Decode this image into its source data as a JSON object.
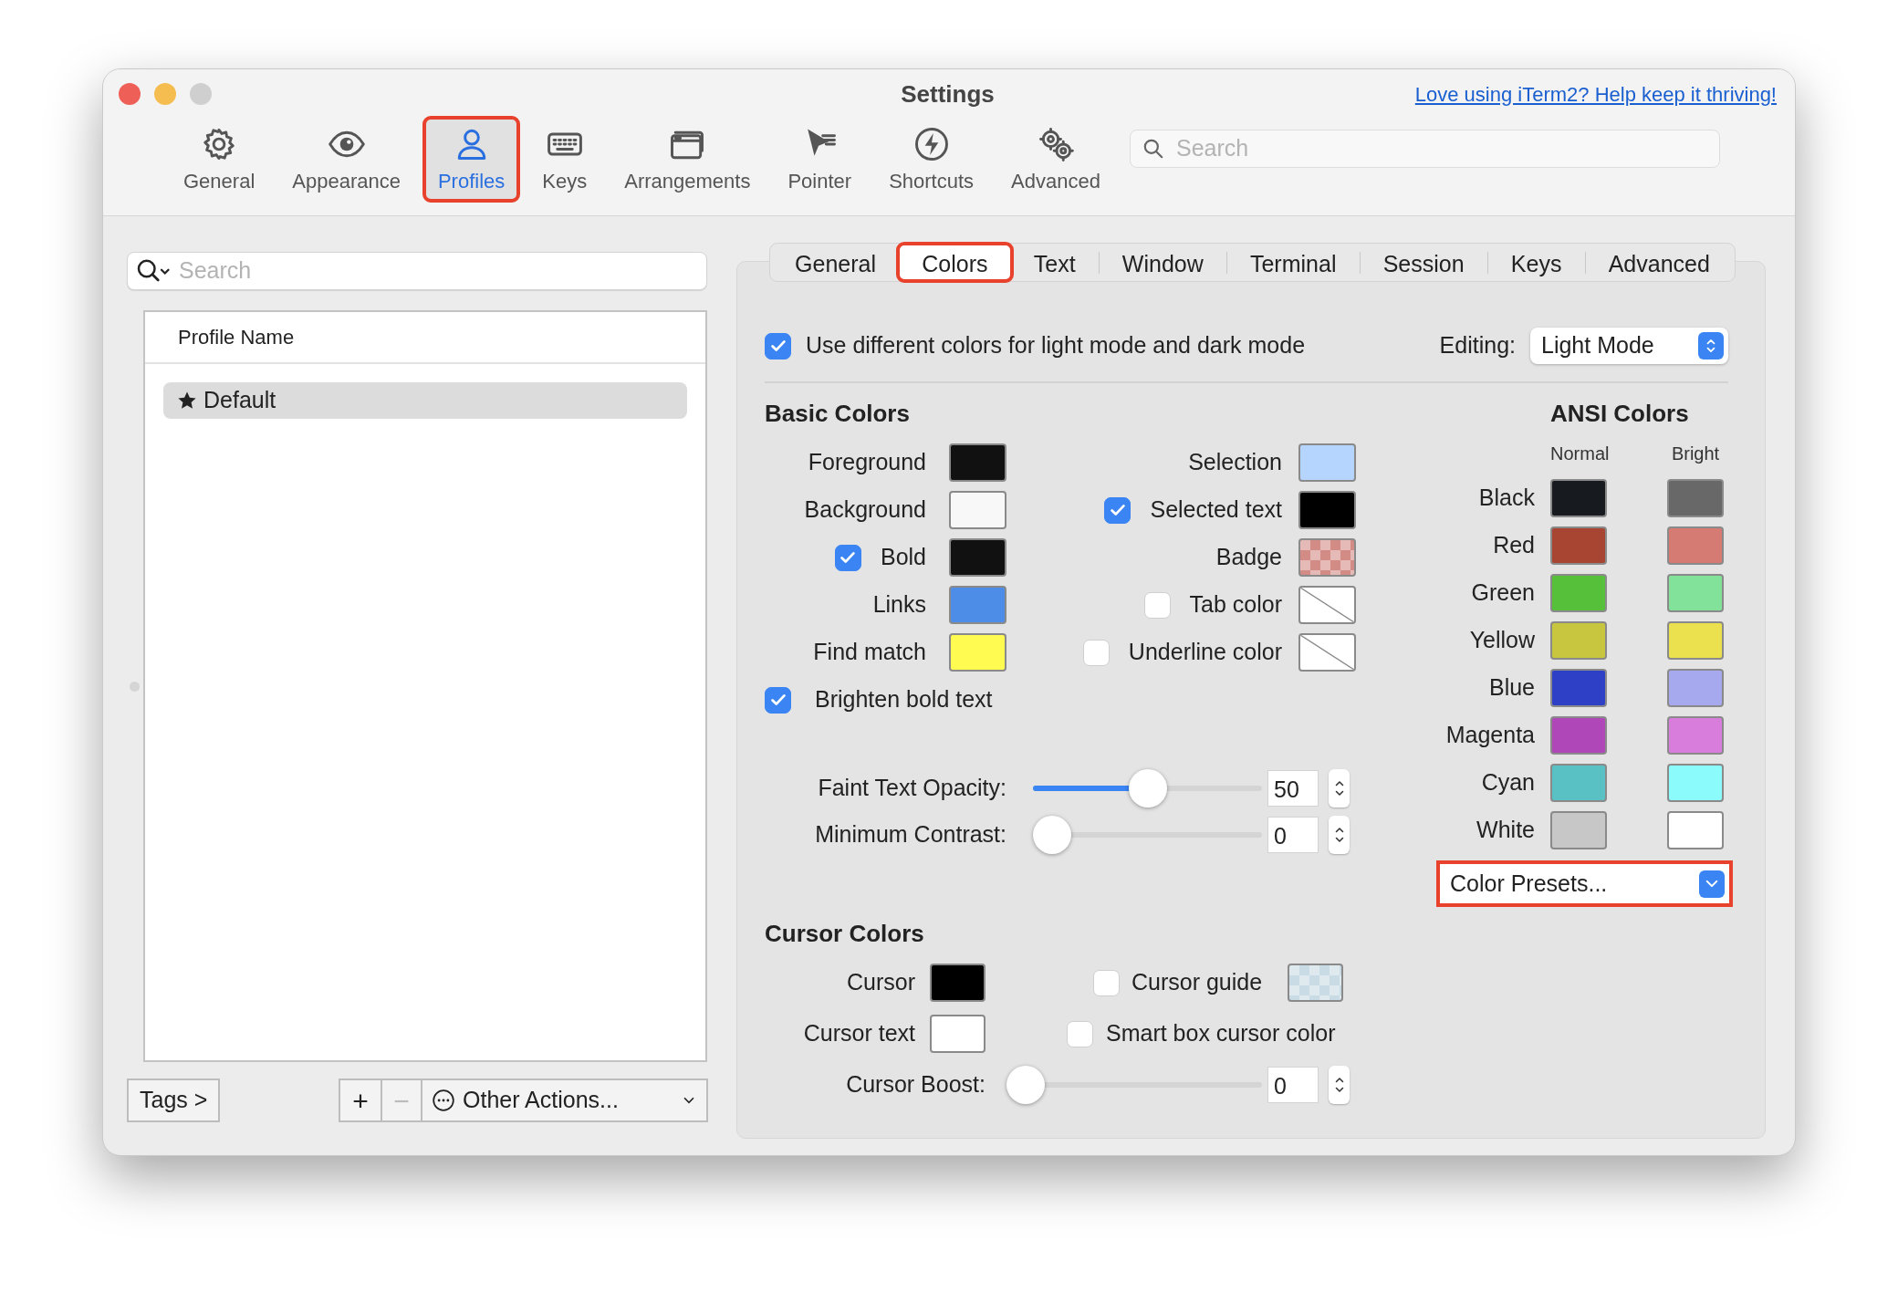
{
  "window": {
    "title": "Settings"
  },
  "promo_link": "Love using iTerm2? Help keep it thriving!",
  "toolbar": {
    "items": [
      {
        "label": "General",
        "selected": false,
        "highlighted": false
      },
      {
        "label": "Appearance",
        "selected": false,
        "highlighted": false
      },
      {
        "label": "Profiles",
        "selected": true,
        "highlighted": true
      },
      {
        "label": "Keys",
        "selected": false,
        "highlighted": false
      },
      {
        "label": "Arrangements",
        "selected": false,
        "highlighted": false
      },
      {
        "label": "Pointer",
        "selected": false,
        "highlighted": false
      },
      {
        "label": "Shortcuts",
        "selected": false,
        "highlighted": false
      },
      {
        "label": "Advanced",
        "selected": false,
        "highlighted": false
      }
    ],
    "search": {
      "placeholder": "Search"
    }
  },
  "profiles": {
    "search": {
      "placeholder": "Search"
    },
    "column": "Profile Name",
    "rows": [
      {
        "name": "Default",
        "selected": true
      }
    ],
    "tags_button": "Tags >",
    "add_button": "+",
    "remove_button": "−",
    "other_actions": "Other Actions..."
  },
  "tabs": [
    {
      "label": "General",
      "selected": false,
      "highlighted": false
    },
    {
      "label": "Colors",
      "selected": true,
      "highlighted": true
    },
    {
      "label": "Text",
      "selected": false,
      "highlighted": false
    },
    {
      "label": "Window",
      "selected": false,
      "highlighted": false
    },
    {
      "label": "Terminal",
      "selected": false,
      "highlighted": false
    },
    {
      "label": "Session",
      "selected": false,
      "highlighted": false
    },
    {
      "label": "Keys",
      "selected": false,
      "highlighted": false
    },
    {
      "label": "Advanced",
      "selected": false,
      "highlighted": false
    }
  ],
  "mode_checkbox": {
    "label": "Use different colors for light mode and dark mode",
    "checked": true
  },
  "editing": {
    "label": "Editing:",
    "value": "Light Mode"
  },
  "basic_colors": {
    "title": "Basic Colors",
    "left": [
      {
        "label": "Foreground",
        "kind": "solid",
        "color": "#111111"
      },
      {
        "label": "Background",
        "kind": "solid",
        "color": "#f8f8f8"
      },
      {
        "label": "Bold",
        "checked": true,
        "kind": "solid",
        "color": "#111111"
      },
      {
        "label": "Links",
        "kind": "solid",
        "color": "#4d8de8"
      },
      {
        "label": "Find match",
        "kind": "solid",
        "color": "#fffb50"
      }
    ],
    "right": [
      {
        "label": "Selection",
        "kind": "solid",
        "color": "#b5d5ff"
      },
      {
        "label": "Selected text",
        "checked": true,
        "kind": "solid",
        "color": "#000000"
      },
      {
        "label": "Badge",
        "kind": "checker",
        "color": "#d38b86"
      },
      {
        "label": "Tab color",
        "checked": false,
        "kind": "empty"
      },
      {
        "label": "Underline color",
        "checked": false,
        "kind": "empty"
      }
    ],
    "brighten_bold": {
      "label": "Brighten bold text",
      "checked": true
    }
  },
  "sliders": [
    {
      "label": "Faint Text Opacity:",
      "level": 0.5,
      "value": "50"
    },
    {
      "label": "Minimum Contrast:",
      "level": 0,
      "value": "0"
    }
  ],
  "ansi_colors": {
    "title": "ANSI Colors",
    "columns": [
      "Normal",
      "Bright"
    ],
    "rows": [
      {
        "label": "Black",
        "swatches": [
          {
            "color": "#171a1e"
          },
          {
            "color": "#686868"
          }
        ]
      },
      {
        "label": "Red",
        "swatches": [
          {
            "color": "#a84432"
          },
          {
            "color": "#d57b74"
          }
        ]
      },
      {
        "label": "Green",
        "swatches": [
          {
            "color": "#56c03b"
          },
          {
            "color": "#83e29a"
          }
        ]
      },
      {
        "label": "Yellow",
        "swatches": [
          {
            "color": "#c8c63e"
          },
          {
            "color": "#ebe04d"
          }
        ]
      },
      {
        "label": "Blue",
        "swatches": [
          {
            "color": "#2e41c6"
          },
          {
            "color": "#a7a9ee"
          }
        ]
      },
      {
        "label": "Magenta",
        "swatches": [
          {
            "color": "#b047b8"
          },
          {
            "color": "#d87ddb"
          }
        ]
      },
      {
        "label": "Cyan",
        "swatches": [
          {
            "color": "#59c1c4"
          },
          {
            "color": "#8cfbfb"
          }
        ]
      },
      {
        "label": "White",
        "swatches": [
          {
            "color": "#c7c7c7"
          },
          {
            "color": "#ffffff"
          }
        ]
      }
    ]
  },
  "color_presets": {
    "label": "Color Presets...",
    "highlighted": true
  },
  "cursor_colors": {
    "title": "Cursor Colors",
    "cursor": {
      "label": "Cursor",
      "kind": "solid",
      "color": "#000000"
    },
    "cursor_text": {
      "label": "Cursor text",
      "kind": "solid",
      "color": "#ffffff"
    },
    "cursor_guide": {
      "label": "Cursor guide",
      "checked": false,
      "kind": "checker",
      "color": "#c9dbe4"
    },
    "smart_box": {
      "label": "Smart box cursor color",
      "checked": false
    },
    "boost": {
      "label": "Cursor Boost:",
      "level": 0,
      "value": "0"
    }
  }
}
